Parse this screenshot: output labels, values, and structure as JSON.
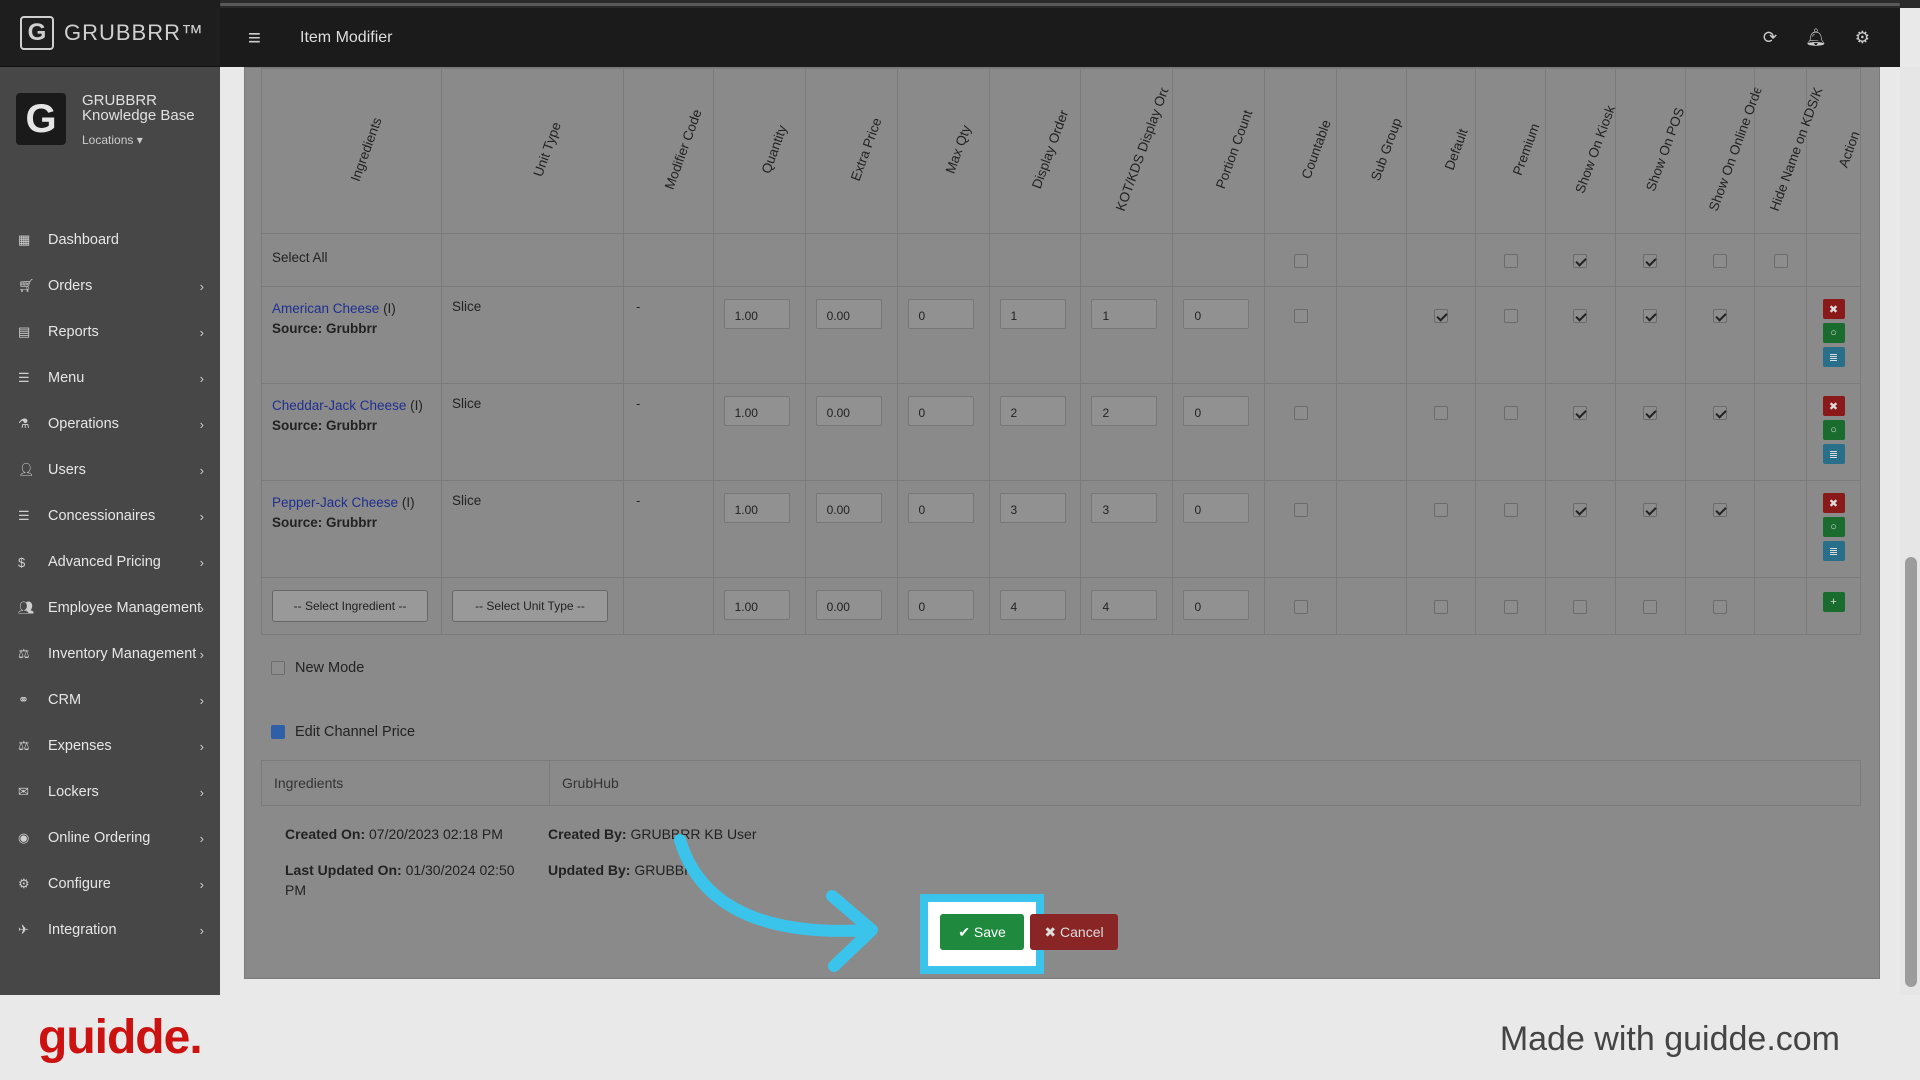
{
  "app": {
    "logo_text": "GRUBBRR™",
    "logo_glyph": "G"
  },
  "brand": {
    "name_line1": "GRUBBRR",
    "name_line2": "Knowledge Base",
    "locations": "Locations ▾"
  },
  "header": {
    "title": "Item Modifier"
  },
  "nav": [
    {
      "label": "Dashboard",
      "icon": "▦"
    },
    {
      "label": "Orders",
      "icon": "🛒︎"
    },
    {
      "label": "Reports",
      "icon": "▤"
    },
    {
      "label": "Menu",
      "icon": "☰"
    },
    {
      "label": "Operations",
      "icon": "⚗"
    },
    {
      "label": "Users",
      "icon": "👤︎"
    },
    {
      "label": "Concessionaires",
      "icon": "☰"
    },
    {
      "label": "Advanced Pricing",
      "icon": "$"
    },
    {
      "label": "Employee Management",
      "icon": "👥︎"
    },
    {
      "label": "Inventory Management",
      "icon": "⚖"
    },
    {
      "label": "CRM",
      "icon": "⚭"
    },
    {
      "label": "Expenses",
      "icon": "⚖"
    },
    {
      "label": "Lockers",
      "icon": "✉"
    },
    {
      "label": "Online Ordering",
      "icon": "◉"
    },
    {
      "label": "Configure",
      "icon": "⚙"
    },
    {
      "label": "Integration",
      "icon": "✈"
    }
  ],
  "columns": [
    "Ingredients",
    "Unit Type",
    "Modifier Code",
    "Quantity",
    "Extra Price",
    "Max Qty",
    "Display Order",
    "KOT/KDS Display Ord",
    "Portion Count",
    "Countable",
    "Sub Group",
    "Default",
    "Premium",
    "Show On Kiosk",
    "Show On POS",
    "Show On Online Orde",
    "Hide Name on KDS/K",
    "Action"
  ],
  "select_all": "Select All",
  "rows": [
    {
      "name": "American Cheese",
      "suffix": " (I)",
      "source": "Source: Grubbrr",
      "unit": "Slice",
      "code": "-",
      "qty": "1.00",
      "extra": "0.00",
      "max": "0",
      "disp": "1",
      "kot": "1",
      "portion": "0"
    },
    {
      "name": "Cheddar-Jack Cheese",
      "suffix": " (I)",
      "source": "Source: Grubbrr",
      "unit": "Slice",
      "code": "-",
      "qty": "1.00",
      "extra": "0.00",
      "max": "0",
      "disp": "2",
      "kot": "2",
      "portion": "0"
    },
    {
      "name": "Pepper-Jack Cheese",
      "suffix": " (I)",
      "source": "Source: Grubbrr",
      "unit": "Slice",
      "code": "-",
      "qty": "1.00",
      "extra": "0.00",
      "max": "0",
      "disp": "3",
      "kot": "3",
      "portion": "0"
    }
  ],
  "new_row": {
    "ingredient_placeholder": "-- Select Ingredient --",
    "unit_placeholder": "-- Select Unit Type --",
    "qty": "1.00",
    "extra": "0.00",
    "max": "0",
    "disp": "4",
    "kot": "4",
    "portion": "0"
  },
  "new_mode": "New Mode",
  "edit_channel_price": "Edit Channel Price",
  "channel_table": {
    "col1": "Ingredients",
    "col2": "GrubHub"
  },
  "meta": {
    "created_on_label": "Created On:",
    "created_on": "07/20/2023 02:18 PM",
    "updated_on_label": "Last Updated On:",
    "updated_on_1": "01/30/2024 02:50",
    "updated_on_2": "PM",
    "created_by_label": "Created By:",
    "created_by": "GRUBBRR KB User",
    "updated_by_label": "Updated By:",
    "updated_by": "GRUBBR"
  },
  "buttons": {
    "save": "✔ Save",
    "cancel": "✖ Cancel"
  },
  "footer": {
    "logo": "guidde.",
    "made_with": "Made with guidde.com"
  },
  "colors": {
    "highlight": "#3ac4ec",
    "save": "#1f8a3e",
    "guidde": "#cc1111"
  }
}
